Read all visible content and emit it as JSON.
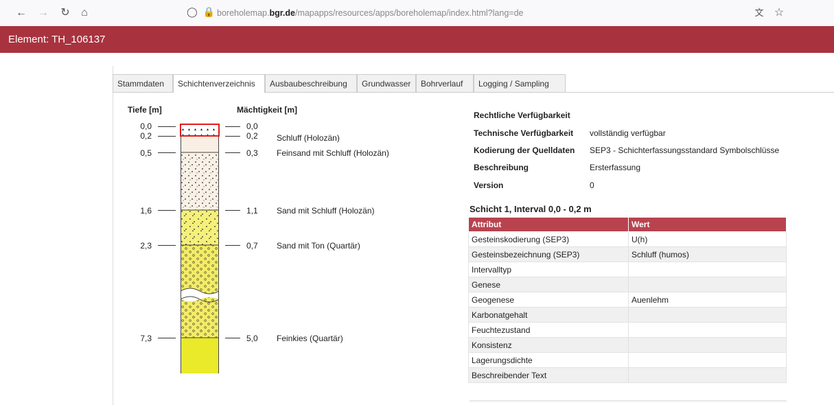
{
  "browser": {
    "url_prefix": "boreholemap.",
    "url_domain": "bgr.de",
    "url_suffix": "/mapapps/resources/apps/boreholemap/index.html?lang=de"
  },
  "window": {
    "title": "Element: TH_106137"
  },
  "tabs": [
    "Stammdaten",
    "Schichtenverzeichnis",
    "Ausbaubeschreibung",
    "Grundwasser",
    "Bohrverlauf",
    "Logging / Sampling"
  ],
  "active_tab": "Schichtenverzeichnis",
  "profile": {
    "depth_header": "Tiefe [m]",
    "thickness_header": "Mächtigkeit [m]",
    "depths": [
      "0,0",
      "0,2",
      "0,5",
      "1,6",
      "2,3",
      "7,3"
    ],
    "thicknesses": [
      "0,0",
      "0,2",
      "0,3",
      "1,1",
      "0,7",
      "5,0"
    ],
    "descriptions": [
      "Schluff (Holozän)",
      "Feinsand mit Schluff (Holozän)",
      "Sand mit Schluff (Holozän)",
      "Sand mit Ton (Quartär)",
      "Feinkies (Quartär)"
    ]
  },
  "metadata": {
    "rows": [
      {
        "label": "Rechtliche Verfügbarkeit",
        "value": ""
      },
      {
        "label": "Technische Verfügbarkeit",
        "value": "vollständig verfügbar"
      },
      {
        "label": "Kodierung der Quelldaten",
        "value": "SEP3 - Schichterfassungsstandard Symbolschlüsse"
      },
      {
        "label": "Beschreibung",
        "value": "Ersterfassung"
      },
      {
        "label": "Version",
        "value": "0"
      }
    ]
  },
  "layer_details": {
    "title": "Schicht 1, Interval 0,0 - 0,2 m",
    "col_attribute": "Attribut",
    "col_value": "Wert",
    "rows": [
      {
        "attr": "Gesteinskodierung (SEP3)",
        "value": "U(h)"
      },
      {
        "attr": "Gesteinsbezeichnung (SEP3)",
        "value": "Schluff (humos)"
      },
      {
        "attr": "Intervalltyp",
        "value": ""
      },
      {
        "attr": "Genese",
        "value": ""
      },
      {
        "attr": "Geogenese",
        "value": "Auenlehm"
      },
      {
        "attr": "Karbonatgehalt",
        "value": ""
      },
      {
        "attr": "Feuchtezustand",
        "value": ""
      },
      {
        "attr": "Konsistenz",
        "value": ""
      },
      {
        "attr": "Lagerungsdichte",
        "value": ""
      },
      {
        "attr": "Beschreibender Text",
        "value": ""
      }
    ]
  },
  "colors": {
    "title_bar": "#a8333f",
    "table_header": "#b8434f",
    "selection": "#e01b1b"
  }
}
